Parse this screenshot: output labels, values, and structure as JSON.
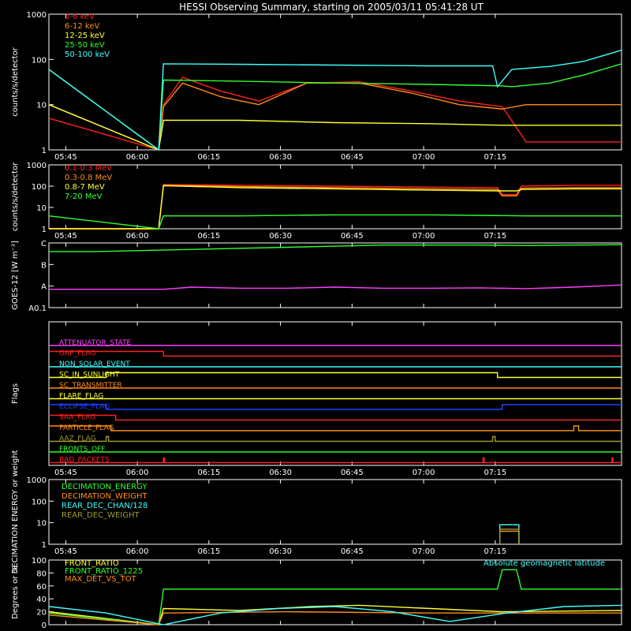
{
  "title": "HESSI Observing Summary, starting on 2005/03/11 05:41:28 UT",
  "time_tick_labels": [
    "05:45",
    "06:00",
    "06:15",
    "06:30",
    "06:45",
    "07:00",
    "07:15"
  ],
  "colors": {
    "axis": "#ffffff",
    "red": "#ff2020",
    "orange": "#ff8c1a",
    "yellow": "#ffff30",
    "green": "#30ff30",
    "cyan": "#40ffff",
    "magenta": "#ff40ff",
    "blue": "#2040ff",
    "olive": "#a09a30"
  },
  "chart_data": [
    {
      "id": "lowE",
      "type": "line",
      "ylabel": "counts/s/detector",
      "yscale": "log",
      "ylim": [
        1,
        1000
      ],
      "ytick_labels": [
        "1",
        "10",
        "100",
        "1000"
      ],
      "x_unit": "minutes after 05:41:28 UT",
      "series": [
        {
          "name": "3-6 keV",
          "color": "red",
          "x": [
            0,
            23,
            24,
            28,
            36,
            44,
            54,
            65,
            76,
            86,
            95,
            100,
            120
          ],
          "y": [
            5,
            1,
            10,
            40,
            20,
            12,
            30,
            32,
            20,
            12,
            9,
            1.5,
            1.5
          ]
        },
        {
          "name": "6-12 keV",
          "color": "orange",
          "x": [
            0,
            23,
            24,
            28,
            36,
            44,
            54,
            65,
            76,
            86,
            95,
            100,
            120
          ],
          "y": [
            10,
            1,
            9,
            30,
            15,
            10,
            30,
            30,
            18,
            10,
            8,
            10,
            10
          ]
        },
        {
          "name": "12-25 keV",
          "color": "yellow",
          "x": [
            0,
            23,
            24,
            40,
            60,
            80,
            95,
            100,
            120
          ],
          "y": [
            10,
            1,
            4.5,
            4.5,
            4,
            3.8,
            3.5,
            3.5,
            3.5
          ]
        },
        {
          "name": "25-50 keV",
          "color": "green",
          "x": [
            0,
            23,
            24,
            40,
            60,
            80,
            95,
            97,
            105,
            112,
            120
          ],
          "y": [
            60,
            1,
            35,
            33,
            30,
            28,
            26,
            25,
            30,
            45,
            80
          ]
        },
        {
          "name": "50-100 keV",
          "color": "cyan",
          "x": [
            0,
            23,
            24,
            40,
            60,
            80,
            93,
            94,
            97,
            105,
            112,
            120
          ],
          "y": [
            60,
            1,
            80,
            78,
            75,
            72,
            72,
            25,
            60,
            70,
            90,
            160
          ]
        }
      ]
    },
    {
      "id": "highE",
      "type": "line",
      "ylabel": "counts/s/detector",
      "yscale": "log",
      "ylim": [
        1,
        1000
      ],
      "ytick_labels": [
        "1",
        "10",
        "100",
        "1000"
      ],
      "x_unit": "minutes after 05:41:28 UT",
      "series": [
        {
          "name": "0.1-0.3 MeV",
          "color": "red",
          "x": [
            0,
            23,
            24,
            40,
            60,
            80,
            94,
            95,
            98,
            99,
            110,
            120
          ],
          "y": [
            1,
            1,
            120,
            110,
            100,
            90,
            85,
            40,
            40,
            100,
            110,
            110
          ]
        },
        {
          "name": "0.3-0.8 MeV",
          "color": "orange",
          "x": [
            0,
            23,
            24,
            40,
            60,
            80,
            94,
            95,
            98,
            99,
            110,
            120
          ],
          "y": [
            1,
            1,
            110,
            95,
            85,
            75,
            70,
            35,
            35,
            80,
            85,
            85
          ]
        },
        {
          "name": "0.8-7 MeV",
          "color": "yellow",
          "x": [
            0,
            23,
            24,
            40,
            60,
            80,
            94,
            95,
            98,
            99,
            110,
            120
          ],
          "y": [
            1,
            1,
            105,
            85,
            75,
            65,
            60,
            60,
            60,
            70,
            75,
            75
          ]
        },
        {
          "name": "7-20 MeV",
          "color": "green",
          "x": [
            0,
            23,
            24,
            40,
            60,
            80,
            100,
            120
          ],
          "y": [
            4,
            1,
            4,
            4,
            4.5,
            4.5,
            4,
            4
          ]
        }
      ]
    },
    {
      "id": "goes",
      "type": "line",
      "ylabel": "GOES-12 [W m⁻²]",
      "ytick_labels": [
        "A0.1",
        "A",
        "B",
        "C"
      ],
      "ylim_levels": [
        0,
        3
      ],
      "x_unit": "minutes after 05:41:28 UT",
      "series": [
        {
          "color": "green",
          "x": [
            0,
            10,
            20,
            30,
            40,
            50,
            60,
            70,
            80,
            90,
            100,
            110,
            120
          ],
          "y": [
            2.6,
            2.6,
            2.65,
            2.7,
            2.75,
            2.8,
            2.85,
            2.9,
            2.9,
            2.9,
            2.88,
            2.9,
            2.92
          ]
        },
        {
          "color": "magenta",
          "x": [
            0,
            10,
            20,
            24,
            30,
            40,
            50,
            60,
            70,
            80,
            90,
            100,
            110,
            120
          ],
          "y": [
            0.85,
            0.85,
            0.85,
            0.85,
            0.95,
            0.9,
            0.9,
            0.95,
            0.9,
            0.9,
            0.92,
            0.88,
            0.95,
            1.05
          ]
        }
      ]
    },
    {
      "id": "decimation",
      "type": "line",
      "ylabel": "DECIMATION ENERGY or weight",
      "yscale": "log",
      "ylim": [
        1,
        1000
      ],
      "ytick_labels": [
        "1",
        "10",
        "100",
        "1000"
      ],
      "x_unit": "minutes after 05:41:28 UT",
      "series": [
        {
          "name": "DECIMATION_ENERGY",
          "color": "green",
          "x": [
            0,
            120
          ],
          "y": [
            0,
            0
          ]
        },
        {
          "name": "DECIMATION_WEIGHT",
          "color": "orange",
          "x": [
            94.5,
            94.5,
            98.5,
            98.5
          ],
          "y": [
            1,
            4,
            4,
            1
          ]
        },
        {
          "name": "REAR_DEC_CHAN/128",
          "color": "cyan",
          "x": [
            94.5,
            94.5,
            98.5,
            98.5
          ],
          "y": [
            1,
            8,
            8,
            1
          ]
        },
        {
          "name": "REAR_DEC_WEIGHT",
          "color": "olive",
          "x": [
            94.5,
            94.5,
            98.5,
            98.5
          ],
          "y": [
            1,
            5,
            5,
            1
          ]
        }
      ]
    },
    {
      "id": "ratio",
      "type": "line",
      "ylabel": "Degrees or %",
      "ylim": [
        0,
        100
      ],
      "ytick_labels": [
        "0",
        "20",
        "40",
        "60",
        "80",
        "100"
      ],
      "annotation": "Absolute geomagnetic latitude",
      "x_unit": "minutes after 05:41:28 UT",
      "series": [
        {
          "name": "FRONT_RATIO",
          "color": "yellow",
          "x": [
            0,
            23,
            24,
            40,
            55,
            65,
            80,
            95,
            120
          ],
          "y": [
            20,
            0,
            25,
            22,
            28,
            30,
            25,
            20,
            22
          ]
        },
        {
          "name": "FRONT_RATIO_1225",
          "color": "green",
          "x": [
            0,
            23,
            24,
            50,
            80,
            94,
            95,
            98,
            99,
            120
          ],
          "y": [
            18,
            0,
            55,
            55,
            55,
            55,
            85,
            85,
            55,
            55
          ]
        },
        {
          "name": "MAX_DET_VS_TOT",
          "color": "orange",
          "x": [
            0,
            23,
            24,
            50,
            80,
            120
          ],
          "y": [
            15,
            0,
            18,
            20,
            18,
            18
          ]
        },
        {
          "name": "Absolute geomagnetic latitude",
          "color": "cyan",
          "x": [
            0,
            12,
            24,
            36,
            48,
            60,
            72,
            84,
            96,
            108,
            120
          ],
          "y": [
            28,
            18,
            0,
            18,
            25,
            28,
            20,
            5,
            18,
            28,
            30
          ]
        }
      ]
    },
    {
      "id": "flags",
      "type": "step",
      "ylabel": "Flags",
      "x_unit": "minutes after 05:41:28 UT",
      "flags": [
        {
          "name": "ATTENUATOR_STATE",
          "color": "magenta",
          "segments": [
            [
              0,
              120,
              0
            ]
          ]
        },
        {
          "name": "GAP_FLAG",
          "color": "red",
          "segments": [
            [
              0,
              24,
              1
            ],
            [
              24,
              120,
              0
            ]
          ]
        },
        {
          "name": "NON_SOLAR_EVENT",
          "color": "cyan",
          "segments": [
            [
              0,
              120,
              0
            ]
          ]
        },
        {
          "name": "SC_IN_SUNLIGHT",
          "color": "yellow",
          "segments": [
            [
              0,
              12,
              0
            ],
            [
              12,
              94,
              1
            ],
            [
              94,
              120,
              0
            ]
          ]
        },
        {
          "name": "SC_TRANSMITTER",
          "color": "orange",
          "segments": [
            [
              0,
              120,
              0
            ]
          ]
        },
        {
          "name": "FLARE_FLAG",
          "color": "yellow",
          "segments": [
            [
              0,
              120,
              0
            ]
          ]
        },
        {
          "name": "ECLIPSE_FLAG",
          "color": "blue",
          "segments": [
            [
              0,
              12,
              1
            ],
            [
              12,
              95,
              0
            ],
            [
              95,
              120,
              1
            ]
          ]
        },
        {
          "name": "SAA_FLAG",
          "color": "red",
          "segments": [
            [
              0,
              14,
              1
            ],
            [
              14,
              120,
              0
            ]
          ]
        },
        {
          "name": "PARTICLE_FLAG",
          "color": "orange",
          "segments": [
            [
              0,
              13,
              1
            ],
            [
              13,
              110,
              0
            ],
            [
              110,
              111,
              1
            ],
            [
              111,
              120,
              0
            ]
          ]
        },
        {
          "name": "AAZ_FLAG",
          "color": "olive",
          "segments": [
            [
              0,
              12,
              0
            ],
            [
              12,
              12.5,
              1
            ],
            [
              12.5,
              93,
              0
            ],
            [
              93,
              93.5,
              1
            ],
            [
              93.5,
              120,
              0
            ]
          ]
        },
        {
          "name": "FRONTS_OFF",
          "color": "green",
          "segments": [
            [
              0,
              120,
              0
            ]
          ]
        },
        {
          "name": "BAD_PACKETS",
          "color": "red",
          "segments": [
            [
              0,
              24,
              0
            ],
            [
              24,
              24.2,
              1
            ],
            [
              24.2,
              91,
              0
            ],
            [
              91,
              91.2,
              1
            ],
            [
              91.2,
              118,
              0
            ],
            [
              118,
              118.2,
              1
            ],
            [
              118.2,
              120,
              0
            ]
          ]
        }
      ]
    }
  ]
}
